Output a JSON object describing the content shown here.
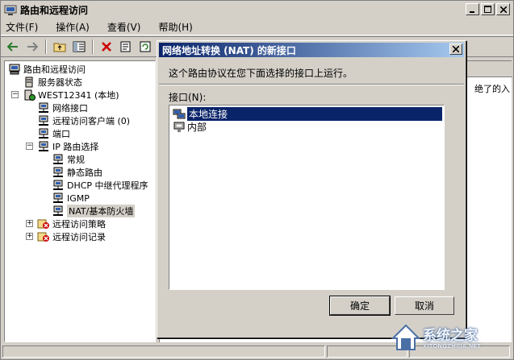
{
  "window": {
    "title": "路由和远程访问"
  },
  "menu": [
    {
      "label": "文件(F)"
    },
    {
      "label": "操作(A)"
    },
    {
      "label": "查看(V)"
    },
    {
      "label": "帮助(H)"
    }
  ],
  "tree": {
    "root": "路由和远程访问",
    "server_status": "服务器状态",
    "server": "WEST12341 (本地)",
    "network_interfaces": "网络接口",
    "remote_clients": "远程访问客户端 (0)",
    "ports": "端口",
    "ip_routing": "IP 路由选择",
    "general": "常规",
    "static_routes": "静态路由",
    "dhcp_relay": "DHCP 中继代理程序",
    "igmp": "IGMP",
    "nat": "NAT/基本防火墙",
    "remote_policy": "远程访问策略",
    "remote_logging": "远程访问记录"
  },
  "right_pane": {
    "truncated_text": "绝了的入"
  },
  "dialog": {
    "title": "网络地址转换 (NAT) 的新接口",
    "description": "这个路由协议在您下面选择的接口上运行。",
    "interfaces_label": "接口(N):",
    "interfaces": [
      "本地连接",
      "内部"
    ],
    "selected_interface": "本地连接",
    "ok_label": "确定",
    "cancel_label": "取消"
  },
  "watermark": {
    "text": "系统之家",
    "sub": "XITONGZHIJIA.NET"
  },
  "colors": {
    "accent": "#0a246a",
    "chrome": "#d4d0c8",
    "error": "#cc0000"
  }
}
